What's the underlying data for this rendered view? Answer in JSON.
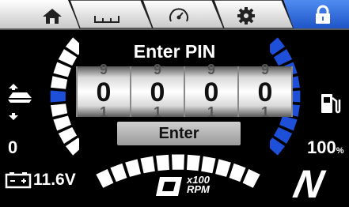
{
  "tabs": [
    {
      "name": "home",
      "icon": "home-icon"
    },
    {
      "name": "trim",
      "icon": "trim-scale-icon"
    },
    {
      "name": "gauge",
      "icon": "speedometer-icon"
    },
    {
      "name": "settings",
      "icon": "gear-icon"
    },
    {
      "name": "lock",
      "icon": "lock-icon",
      "active": true
    }
  ],
  "pin": {
    "title": "Enter PIN",
    "digits": [
      {
        "prev": "9",
        "value": "0",
        "next": "1"
      },
      {
        "prev": "9",
        "value": "0",
        "next": "1"
      },
      {
        "prev": "9",
        "value": "0",
        "next": "1"
      },
      {
        "prev": "9",
        "value": "0",
        "next": "1"
      }
    ],
    "enter_label": "Enter"
  },
  "trim": {
    "value": "0",
    "icon": "trim-icon"
  },
  "fuel": {
    "value": "100",
    "unit": "%",
    "level": 1.0,
    "icon": "fuel-pump-icon"
  },
  "battery": {
    "value": "11.6V",
    "icon": "battery-icon"
  },
  "rpm": {
    "value": "0",
    "multiplier": "x100",
    "unit": "RPM"
  },
  "gear": {
    "value": "N"
  },
  "colors": {
    "accent": "#1e4fd8",
    "tab_active": "#2d6de0"
  }
}
